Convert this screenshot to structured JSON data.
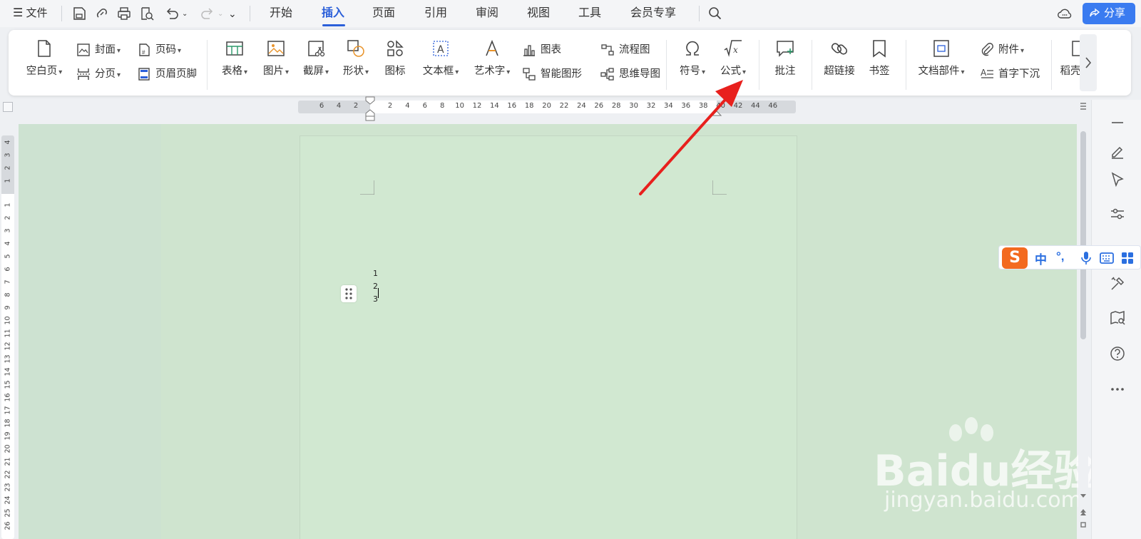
{
  "menubar": {
    "file_label": "文件",
    "tabs": [
      "开始",
      "插入",
      "页面",
      "引用",
      "审阅",
      "视图",
      "工具",
      "会员专享"
    ],
    "active_tab": "插入",
    "share_label": "分享"
  },
  "ribbon": {
    "blank_page": "空白页",
    "cover": "封面",
    "page_number": "页码",
    "page_break": "分页",
    "header_footer": "页眉页脚",
    "table": "表格",
    "picture": "图片",
    "screenshot": "截屏",
    "shape": "形状",
    "icon": "图标",
    "textbox": "文本框",
    "wordart": "艺术字",
    "chart": "图表",
    "smartart": "智能图形",
    "flowchart": "流程图",
    "mindmap": "思维导图",
    "symbol": "符号",
    "equation": "公式",
    "comment": "批注",
    "hyperlink": "超链接",
    "bookmark": "书签",
    "doc_parts": "文档部件",
    "attachment": "附件",
    "drop_cap": "首字下沉",
    "docer": "稻壳"
  },
  "ruler": {
    "h_ticks_left": [
      "6",
      "4",
      "2"
    ],
    "h_ticks_right": [
      "2",
      "4",
      "6",
      "8",
      "10",
      "12",
      "14",
      "16",
      "18",
      "20",
      "22",
      "24",
      "26",
      "28",
      "30",
      "32",
      "34",
      "36",
      "38",
      "40",
      "42",
      "44",
      "46"
    ],
    "v_ticks_top": [
      "4",
      "3",
      "2",
      "1"
    ],
    "v_ticks_main": [
      "1",
      "2",
      "3",
      "4",
      "5",
      "6",
      "7",
      "8",
      "9",
      "10",
      "11",
      "12",
      "13",
      "14",
      "15",
      "16",
      "17",
      "18",
      "19",
      "20",
      "21",
      "22",
      "23",
      "24",
      "25",
      "26"
    ]
  },
  "document": {
    "lines": [
      "1",
      "2",
      "3"
    ]
  },
  "ime": {
    "logo": "S",
    "mode": "中",
    "punct": "°,"
  },
  "watermark": {
    "brand": "Baidu经验",
    "url": "jingyan.baidu.com"
  },
  "colors": {
    "accent": "#2b5fd9",
    "share": "#3a7bf0",
    "doc_bg": "#cfe4cf",
    "arrow": "#e8201d",
    "ime": "#f36a1f"
  }
}
